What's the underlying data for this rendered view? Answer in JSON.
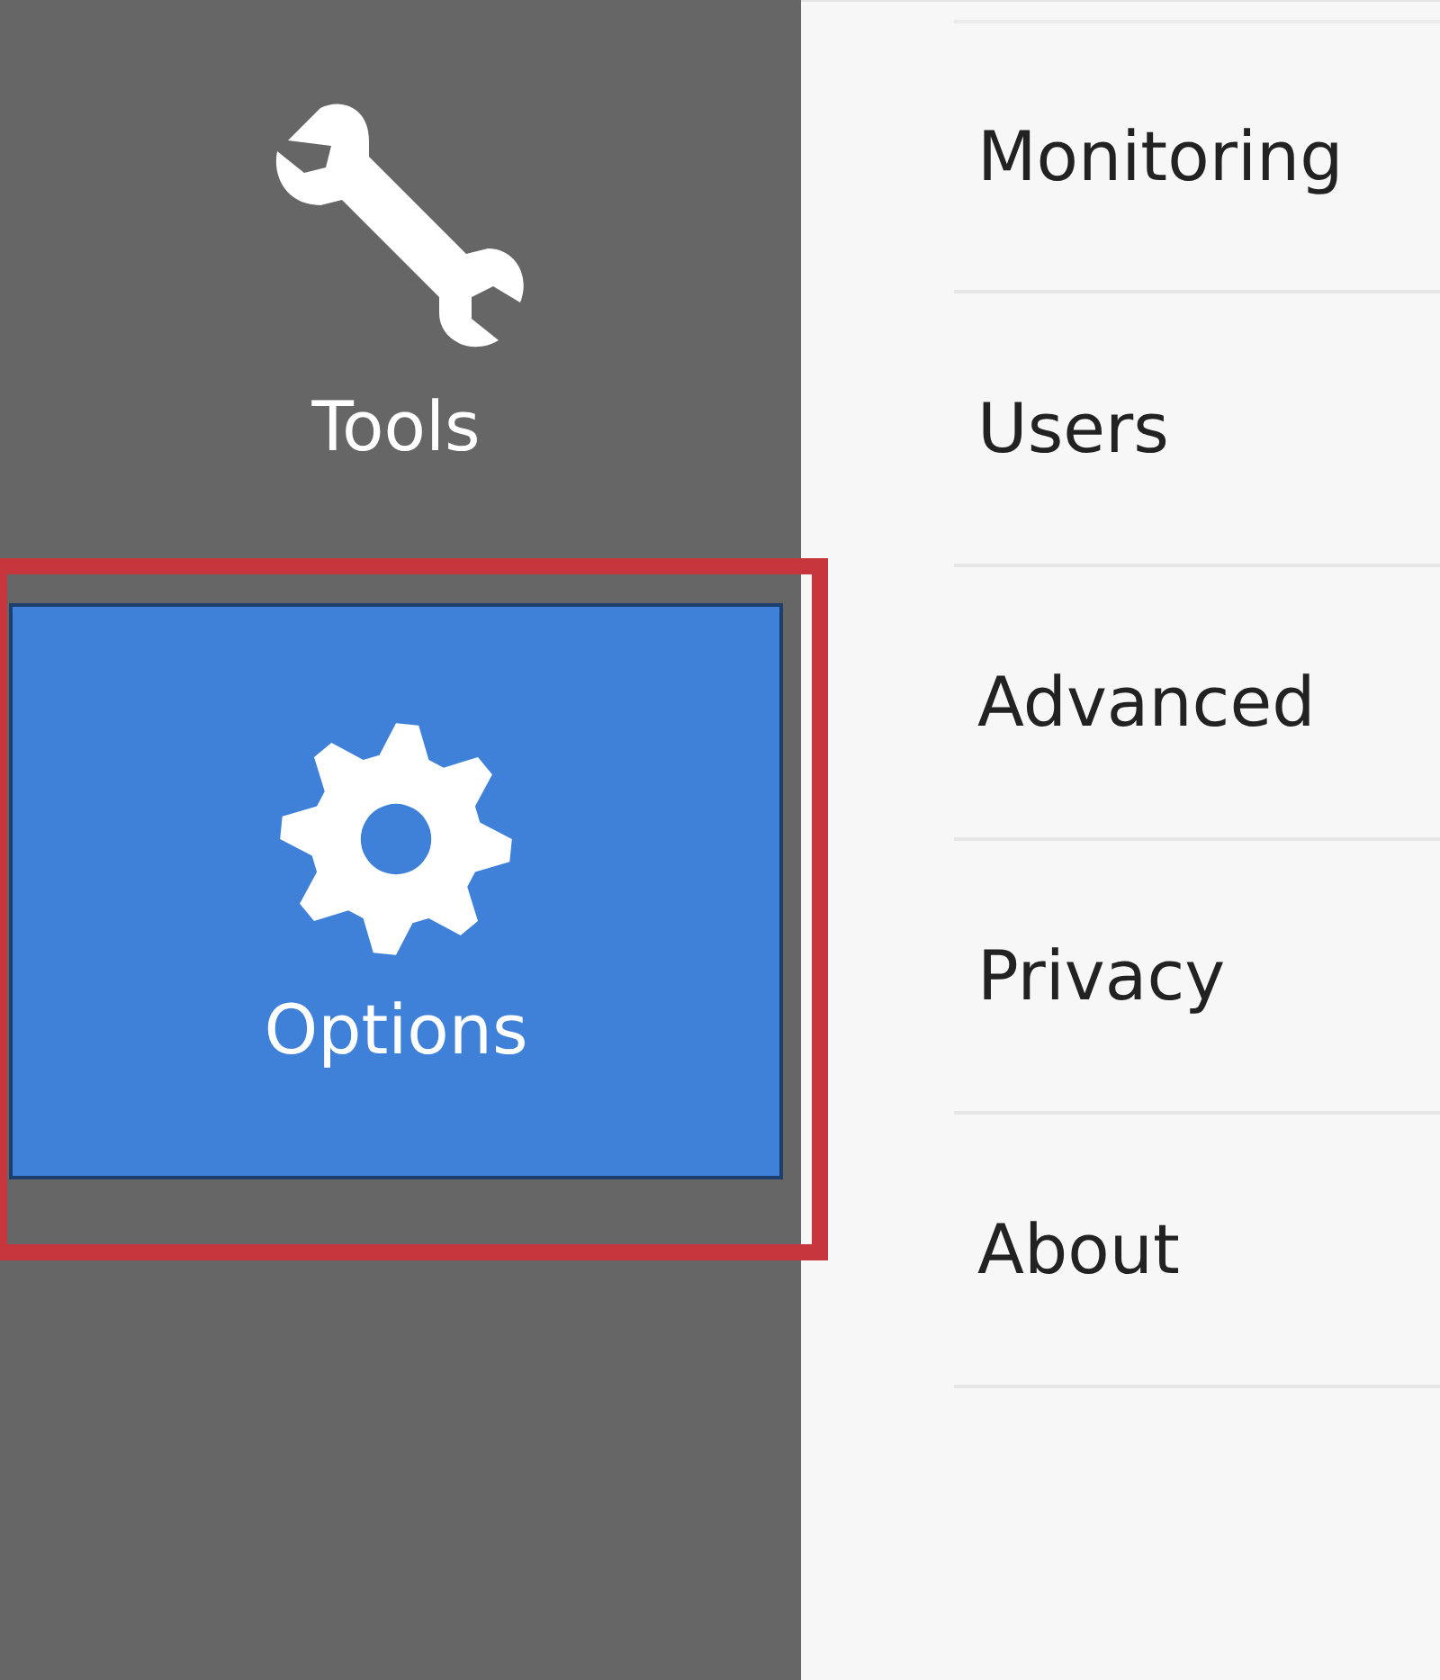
{
  "sidebar": {
    "items": [
      {
        "kind": "wrench",
        "label": "Tools",
        "selected": false,
        "highlighted": false
      },
      {
        "kind": "gear",
        "label": "Options",
        "selected": true,
        "highlighted": true
      }
    ]
  },
  "menu": {
    "items": [
      {
        "label": "Monitoring"
      },
      {
        "label": "Users"
      },
      {
        "label": "Advanced"
      },
      {
        "label": "Privacy"
      },
      {
        "label": "About"
      }
    ]
  }
}
